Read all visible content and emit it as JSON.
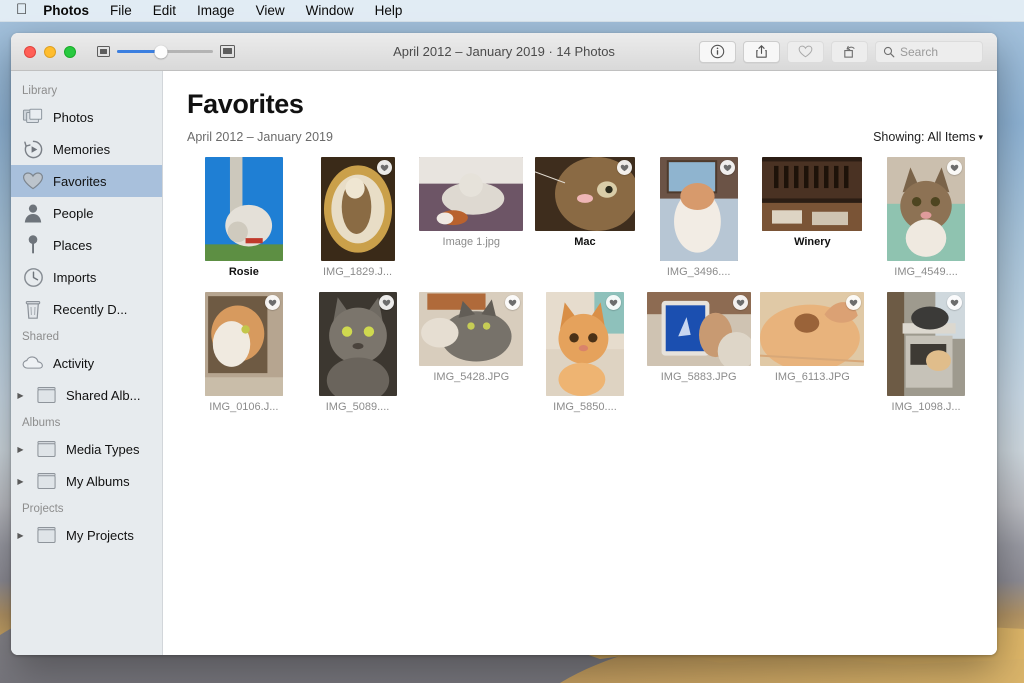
{
  "menubar": {
    "apple_icon": "apple-logo-icon",
    "items": [
      {
        "label": "Photos",
        "bold": true
      },
      {
        "label": "File",
        "bold": false
      },
      {
        "label": "Edit",
        "bold": false
      },
      {
        "label": "Image",
        "bold": false
      },
      {
        "label": "View",
        "bold": false
      },
      {
        "label": "Window",
        "bold": false
      },
      {
        "label": "Help",
        "bold": false
      }
    ]
  },
  "window": {
    "title": "April 2012 – January 2019 · 14 Photos",
    "traffic_lights": {
      "close": "close-button",
      "minimize": "minimize-button",
      "zoom": "maximize-button"
    },
    "zoom_slider": {
      "min_icon": "small-thumbnail-icon",
      "max_icon": "large-thumbnail-icon",
      "value_percent": 46
    },
    "toolbar": {
      "info_label": "info-button",
      "share_label": "share-button",
      "favorite_label": "favorite-button",
      "rotate_label": "rotate-button",
      "search_placeholder": "Search"
    }
  },
  "sidebar": {
    "sections": [
      {
        "title": "Library",
        "items": [
          {
            "label": "Photos",
            "icon": "photos-stack-icon",
            "selected": false,
            "disclosure": false
          },
          {
            "label": "Memories",
            "icon": "memories-icon",
            "selected": false,
            "disclosure": false
          },
          {
            "label": "Favorites",
            "icon": "heart-icon",
            "selected": true,
            "disclosure": false
          },
          {
            "label": "People",
            "icon": "person-icon",
            "selected": false,
            "disclosure": false
          },
          {
            "label": "Places",
            "icon": "pin-icon",
            "selected": false,
            "disclosure": false
          },
          {
            "label": "Imports",
            "icon": "clock-icon",
            "selected": false,
            "disclosure": false
          },
          {
            "label": "Recently D...",
            "icon": "trash-icon",
            "selected": false,
            "disclosure": false
          }
        ]
      },
      {
        "title": "Shared",
        "items": [
          {
            "label": "Activity",
            "icon": "cloud-icon",
            "selected": false,
            "disclosure": false
          },
          {
            "label": "Shared Alb...",
            "icon": "album-folder-icon",
            "selected": false,
            "disclosure": true
          }
        ]
      },
      {
        "title": "Albums",
        "items": [
          {
            "label": "Media Types",
            "icon": "album-folder-icon",
            "selected": false,
            "disclosure": true
          },
          {
            "label": "My Albums",
            "icon": "album-folder-icon",
            "selected": false,
            "disclosure": true
          }
        ]
      },
      {
        "title": "Projects",
        "items": [
          {
            "label": "My Projects",
            "icon": "album-folder-icon",
            "selected": false,
            "disclosure": true
          }
        ]
      }
    ]
  },
  "main": {
    "title": "Favorites",
    "date_range": "April 2012 – January 2019",
    "showing_label": "Showing:",
    "showing_value": "All Items",
    "showing_chevron": "chevron-down-icon",
    "photos": [
      {
        "caption": "Rosie",
        "named": true,
        "favorited": false,
        "w": 78,
        "h": 104,
        "kind": "dog-monument"
      },
      {
        "caption": "IMG_1829.J...",
        "named": false,
        "favorited": true,
        "w": 74,
        "h": 104,
        "kind": "cat-basket"
      },
      {
        "caption": "Image 1.jpg",
        "named": false,
        "favorited": false,
        "w": 104,
        "h": 74,
        "kind": "white-dog-toy"
      },
      {
        "caption": "Mac",
        "named": true,
        "favorited": true,
        "w": 100,
        "h": 74,
        "kind": "cat-closeup"
      },
      {
        "caption": "IMG_3496....",
        "named": false,
        "favorited": true,
        "w": 78,
        "h": 104,
        "kind": "cat-held-window"
      },
      {
        "caption": "Winery",
        "named": true,
        "favorited": false,
        "w": 100,
        "h": 74,
        "kind": "winery-shelves"
      },
      {
        "caption": "IMG_4549....",
        "named": false,
        "favorited": true,
        "w": 78,
        "h": 104,
        "kind": "tabby-green"
      },
      {
        "caption": "IMG_0106.J...",
        "named": false,
        "favorited": true,
        "w": 78,
        "h": 104,
        "kind": "fluffy-orange-mirror"
      },
      {
        "caption": "IMG_5089....",
        "named": false,
        "favorited": true,
        "w": 78,
        "h": 104,
        "kind": "grey-cat-dark"
      },
      {
        "caption": "IMG_5428.JPG",
        "named": false,
        "favorited": true,
        "w": 104,
        "h": 74,
        "kind": "grey-cat-bed"
      },
      {
        "caption": "IMG_5850....",
        "named": false,
        "favorited": true,
        "w": 78,
        "h": 104,
        "kind": "orange-kitten"
      },
      {
        "caption": "IMG_5883.JPG",
        "named": false,
        "favorited": true,
        "w": 104,
        "h": 74,
        "kind": "ipad-lap"
      },
      {
        "caption": "IMG_6113.JPG",
        "named": false,
        "favorited": true,
        "w": 104,
        "h": 74,
        "kind": "orange-cat-belly"
      },
      {
        "caption": "IMG_1098.J...",
        "named": false,
        "favorited": true,
        "w": 78,
        "h": 104,
        "kind": "cats-shelf"
      }
    ]
  }
}
